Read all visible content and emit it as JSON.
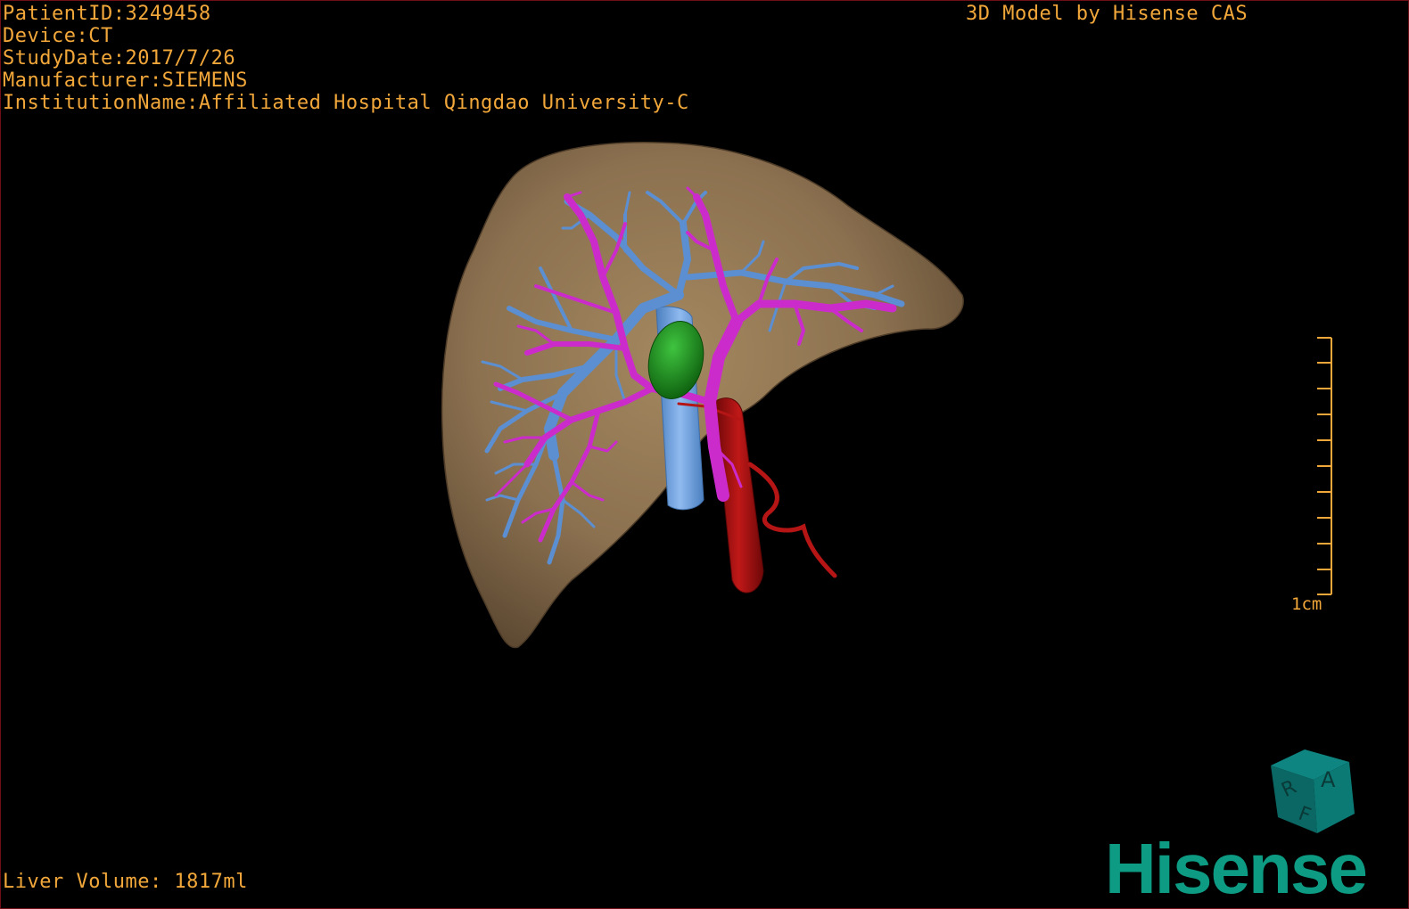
{
  "overlay": {
    "patient_id": "PatientID:3249458",
    "device": "Device:CT",
    "study_date": "StudyDate:2017/7/26",
    "manufacturer": "Manufacturer:SIEMENS",
    "institution": "InstitutionName:Affiliated Hospital Qingdao University-C",
    "model_credit": "3D Model by Hisense CAS",
    "liver_volume": "Liver Volume: 1817ml"
  },
  "scale_bar": {
    "label": "1cm"
  },
  "orientation_cube": {
    "labels": [
      "A",
      "R",
      "F"
    ],
    "color": "#0b6e6a"
  },
  "brand": {
    "name": "Hisense",
    "color": "#0d9b84"
  },
  "colors": {
    "overlay_text": "#f2a73a",
    "liver": "#8c7150",
    "portal_vein": "#5b8fd1",
    "hepatic_artery": "#cc2bcc",
    "gallbladder": "#1a8a1a",
    "aorta": "#b00f0f",
    "ivc": "#6fa2de",
    "frame_border": "#6e0e16"
  }
}
